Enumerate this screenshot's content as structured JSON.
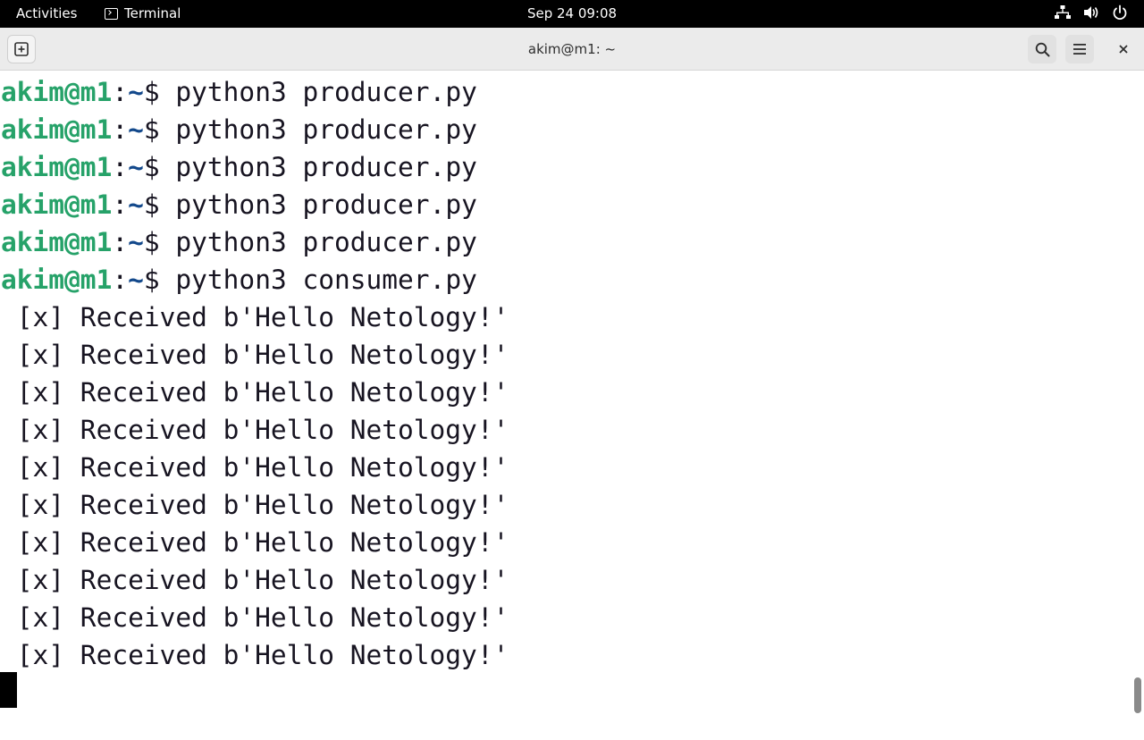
{
  "topbar": {
    "activities_label": "Activities",
    "app_label": "Terminal",
    "clock": "Sep 24  09:08",
    "tray_icons": [
      "network-icon",
      "volume-icon",
      "power-icon"
    ]
  },
  "window": {
    "title": "akim@m1: ~",
    "buttons": [
      "new-tab-icon",
      "search-icon",
      "menu-icon",
      "close-icon"
    ]
  },
  "terminal": {
    "prompt": {
      "user_host": "akim@m1",
      "colon": ":",
      "path": "~",
      "dollar": "$ "
    },
    "commands": [
      "python3 producer.py",
      "python3 producer.py",
      "python3 producer.py",
      "python3 producer.py",
      "python3 producer.py",
      "python3 consumer.py"
    ],
    "output": [
      " [x] Received b'Hello Netology!'",
      " [x] Received b'Hello Netology!'",
      " [x] Received b'Hello Netology!'",
      " [x] Received b'Hello Netology!'",
      " [x] Received b'Hello Netology!'",
      " [x] Received b'Hello Netology!'",
      " [x] Received b'Hello Netology!'",
      " [x] Received b'Hello Netology!'",
      " [x] Received b'Hello Netology!'",
      " [x] Received b'Hello Netology!'"
    ]
  },
  "colors": {
    "prompt_user": "#26a269",
    "prompt_path": "#12488b",
    "text": "#171421",
    "topbar_bg": "#000000",
    "headerbar_bg": "#ebebeb"
  }
}
